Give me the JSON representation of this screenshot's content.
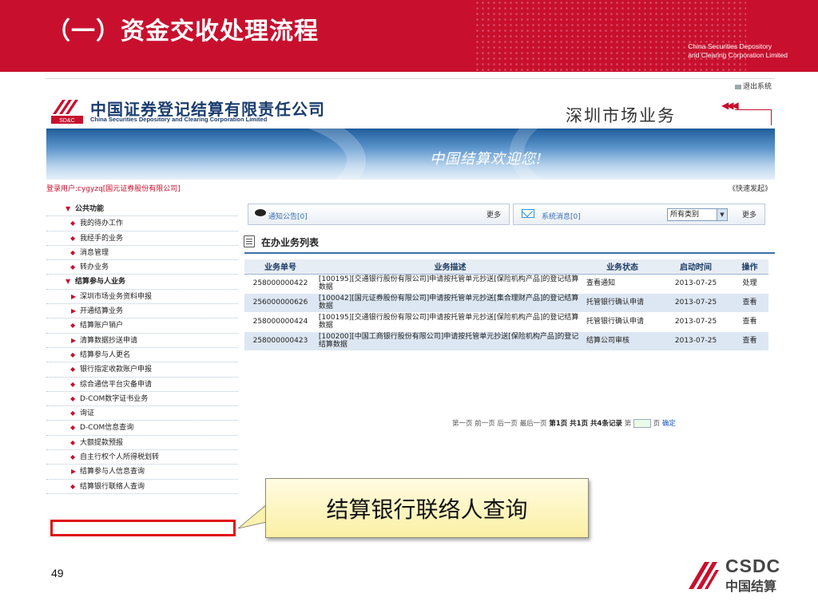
{
  "slide": {
    "title": "（一）资金交收处理流程",
    "company_en_1": "China Securities Depository",
    "company_en_2": "and Clearing Corporation Limited",
    "page_number": "49"
  },
  "app": {
    "logout": "退出系统",
    "company_cn": "中国证券登记结算有限责任公司",
    "company_en": "China Securities Depository and Clearing Corporation Limited",
    "logo_abbr": "SD&C",
    "market": "深圳市场业务",
    "welcome": "中国结算欢迎您!",
    "user": "登录用户:cygyzq[国元证券股份有限公司]",
    "quick": "《快速发起》"
  },
  "sidebar": {
    "items": [
      {
        "label": "公共功能",
        "kind": "sec",
        "mark": "▼"
      },
      {
        "label": "我的待办工作",
        "kind": "bul",
        "mark": "◆"
      },
      {
        "label": "我经手的业务",
        "kind": "bul",
        "mark": "◆"
      },
      {
        "label": "消息管理",
        "kind": "bul",
        "mark": "◆"
      },
      {
        "label": "转办业务",
        "kind": "bul",
        "mark": "◆"
      },
      {
        "label": "结算参与人业务",
        "kind": "sec",
        "mark": "▼"
      },
      {
        "label": "深圳市场业务资料申报",
        "kind": "arr",
        "mark": "▶"
      },
      {
        "label": "开通结算业务",
        "kind": "arr",
        "mark": "▶"
      },
      {
        "label": "结算账户销户",
        "kind": "bul",
        "mark": "◆"
      },
      {
        "label": "清算数据抄送申请",
        "kind": "arr",
        "mark": "▶"
      },
      {
        "label": "结算参与人更名",
        "kind": "bul",
        "mark": "◆"
      },
      {
        "label": "银行指定收款账户申报",
        "kind": "bul",
        "mark": "◆"
      },
      {
        "label": "综合通信平台灾备申请",
        "kind": "bul",
        "mark": "◆"
      },
      {
        "label": "D-COM数字证书业务",
        "kind": "bul",
        "mark": "◆"
      },
      {
        "label": "询证",
        "kind": "bul",
        "mark": "◆"
      },
      {
        "label": "D-COM信息查询",
        "kind": "bul",
        "mark": "◆"
      },
      {
        "label": "大额提款预报",
        "kind": "bul",
        "mark": "◆"
      },
      {
        "label": "自主行权个人所得税划转",
        "kind": "bul",
        "mark": "◆"
      },
      {
        "label": "结算参与人信息查询",
        "kind": "arr",
        "mark": "▶"
      },
      {
        "label": "结算银行联络人查询",
        "kind": "bul",
        "mark": "◆"
      }
    ]
  },
  "notices": {
    "notice_label": "通知公告[0]",
    "more": "更多",
    "sys_label": "系统消息[0]",
    "category": "所有类别"
  },
  "list": {
    "title": "在办业务列表",
    "headers": [
      "业务单号",
      "业务描述",
      "业务状态",
      "启动时间",
      "操作"
    ],
    "rows": [
      [
        "258000000422",
        "[100195][交通银行股份有限公司]申请按托管单元抄送[保险机构产品]的登记结算数据",
        "查看通知",
        "2013-07-25",
        "处理"
      ],
      [
        "256000000626",
        "[100042][国元证券股份有限公司]申请按托管单元抄送[集合理财产品]的登记结算数据",
        "托管银行确认申请",
        "2013-07-25",
        "查看"
      ],
      [
        "258000000424",
        "[100195][交通银行股份有限公司]申请按托管单元抄送[保险机构产品]的登记结算数据",
        "托管银行确认申请",
        "2013-07-25",
        "查看"
      ],
      [
        "258000000423",
        "[100200][中国工商银行股份有限公司]申请按托管单元抄送[保险机构产品]的登记结算数据",
        "结算公司审核",
        "2013-07-25",
        "查看"
      ]
    ]
  },
  "pager": {
    "nav": "第一页 前一页 后一页 最后一页",
    "info": "第1页 共1页 共4条记录",
    "goto": "第",
    "page": "页",
    "confirm": "确定"
  },
  "callout": {
    "text": "结算银行联络人查询"
  },
  "footer": {
    "csdc": "CSDC",
    "cn": "中国结算"
  },
  "colors": {
    "brand_red": "#c8102e",
    "link_blue": "#3a6cb6",
    "table_head": "#1d3d66"
  }
}
